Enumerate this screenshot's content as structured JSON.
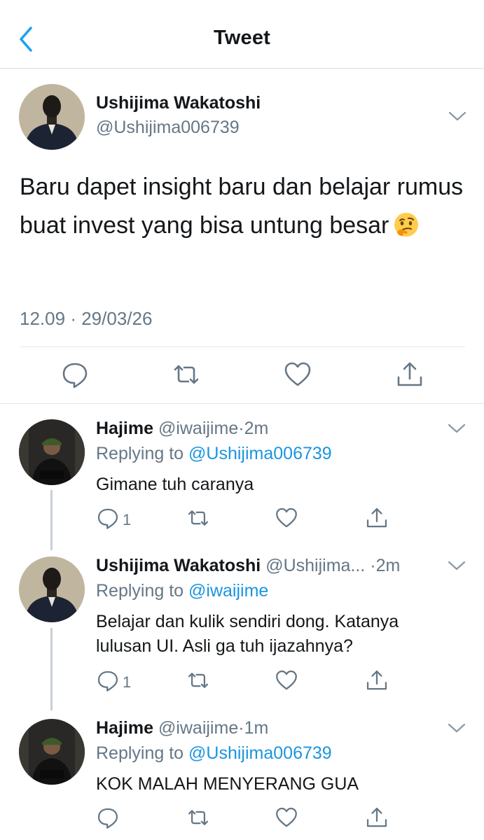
{
  "header": {
    "title": "Tweet"
  },
  "main_tweet": {
    "name": "Ushijima Wakatoshi",
    "handle": "@Ushijima006739",
    "text": "Baru dapet insight baru dan belajar rumus buat invest yang bisa untung besar",
    "emoji": "thinking-face",
    "time": "12.09",
    "date_sep": "·",
    "date": "29/03/26"
  },
  "replies": [
    {
      "name": "Hajime",
      "handle": "@iwaijime",
      "sep": "·",
      "time": "2m",
      "replying_label": "Replying to",
      "replying_to": "@Ushijima006739",
      "text": "Gimane tuh caranya",
      "reply_count": "1"
    },
    {
      "name": "Ushijima Wakatoshi",
      "handle": "@Ushijima...",
      "sep": "·",
      "time": "2m",
      "replying_label": "Replying to",
      "replying_to": "@iwaijime",
      "text": "Belajar dan kulik sendiri dong. Katanya lulusan UI. Asli ga tuh ijazahnya?",
      "reply_count": "1"
    },
    {
      "name": "Hajime",
      "handle": "@iwaijime",
      "sep": "·",
      "time": "1m",
      "replying_label": "Replying to",
      "replying_to": "@Ushijima006739",
      "text": "KOK MALAH MENYERANG GUA",
      "reply_count": ""
    }
  ],
  "icons": {
    "back": "chevron-left-icon",
    "more": "chevron-down-icon",
    "reply": "reply-icon",
    "retweet": "retweet-icon",
    "like": "heart-icon",
    "share": "share-icon"
  },
  "colors": {
    "accent": "#1da1f2",
    "link": "#1b95e0",
    "muted": "#657786",
    "text": "#14171a"
  }
}
